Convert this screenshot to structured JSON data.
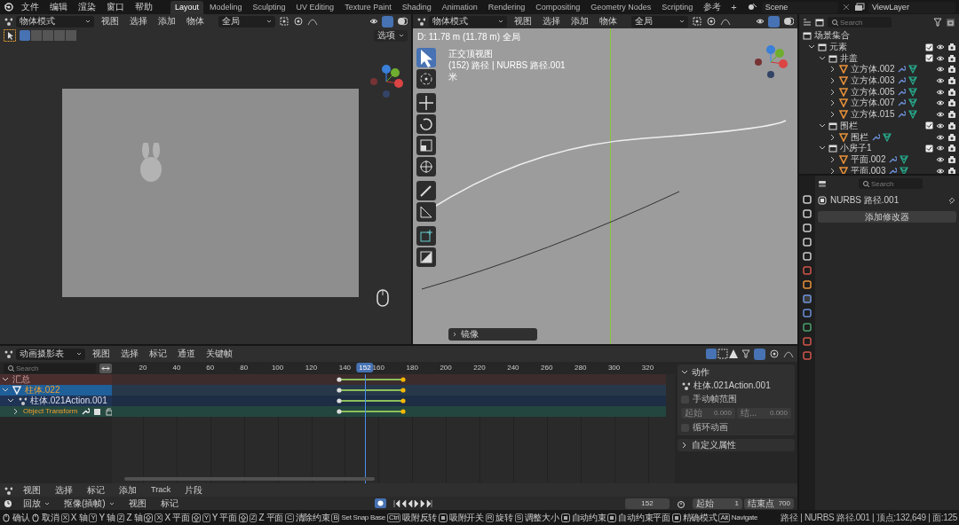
{
  "topbar": {
    "menus": [
      "文件",
      "编辑",
      "渲染",
      "窗口",
      "帮助"
    ],
    "workspaces": [
      {
        "label": "Layout",
        "selected": true
      },
      {
        "label": "Modeling",
        "selected": false
      },
      {
        "label": "Sculpting",
        "selected": false
      },
      {
        "label": "UV Editing",
        "selected": false
      },
      {
        "label": "Texture Paint",
        "selected": false
      },
      {
        "label": "Shading",
        "selected": false
      },
      {
        "label": "Animation",
        "selected": false
      },
      {
        "label": "Rendering",
        "selected": false
      },
      {
        "label": "Compositing",
        "selected": false
      },
      {
        "label": "Geometry Nodes",
        "selected": false
      },
      {
        "label": "Scripting",
        "selected": false
      },
      {
        "label": "参考",
        "selected": false
      }
    ],
    "add": "+",
    "scene": "Scene",
    "view_layer": "ViewLayer"
  },
  "viewport_left": {
    "mode": "物体模式",
    "menus": [
      "视图",
      "选择",
      "添加",
      "物体"
    ],
    "orientation": "全局",
    "options": "选项"
  },
  "viewport_right": {
    "mode": "物体模式",
    "menus": [
      "视图",
      "选择",
      "添加",
      "物体"
    ],
    "orientation": "全局",
    "measure": "D: 11.78 m (11.78 m) 全局",
    "info": [
      "正交顶视图",
      "(152) 路径 | NURBS 路径.001",
      "米"
    ],
    "tools": [
      {
        "kind": "select",
        "selected": true
      },
      {
        "kind": "cursor",
        "selected": false
      },
      {
        "kind": "move",
        "selected": false
      },
      {
        "kind": "rotate",
        "selected": false
      },
      {
        "kind": "scale",
        "selected": false
      },
      {
        "kind": "transform",
        "selected": false
      },
      {
        "kind": "annotate",
        "selected": false
      },
      {
        "kind": "measure",
        "selected": false
      },
      {
        "kind": "add",
        "selected": false
      },
      {
        "kind": "shear",
        "selected": false
      }
    ],
    "last_operator": "镜像"
  },
  "outliner": {
    "search_placeholder": "Search",
    "items": [
      {
        "label": "场景集合",
        "kind": "scene",
        "children": [
          {
            "label": "元素",
            "kind": "collection",
            "checked": true,
            "children": [
              {
                "label": "井盖",
                "kind": "collection",
                "checked": true,
                "children": [
                  {
                    "label": "立方体.002",
                    "kind": "mesh"
                  },
                  {
                    "label": "立方体.003",
                    "kind": "mesh"
                  },
                  {
                    "label": "立方体.005",
                    "kind": "mesh"
                  },
                  {
                    "label": "立方体.007",
                    "kind": "mesh"
                  },
                  {
                    "label": "立方体.015",
                    "kind": "mesh"
                  }
                ]
              },
              {
                "label": "围栏",
                "kind": "collection",
                "checked": true,
                "children": [
                  {
                    "label": "围栏",
                    "kind": "mesh"
                  }
                ]
              },
              {
                "label": "小房子1",
                "kind": "collection",
                "checked": true,
                "children": [
                  {
                    "label": "平面.002",
                    "kind": "mesh"
                  },
                  {
                    "label": "平面.003",
                    "kind": "mesh"
                  }
                ]
              }
            ]
          }
        ]
      }
    ]
  },
  "properties": {
    "search_placeholder": "Search",
    "object": "NURBS 路径.001",
    "add_modifier": "添加修改器"
  },
  "dopesheet": {
    "mode": "动画摄影表",
    "menus": [
      "视图",
      "选择",
      "标记",
      "通道",
      "关键帧"
    ],
    "search_placeholder": "Search",
    "ticks": [
      "20",
      "40",
      "60",
      "80",
      "100",
      "120",
      "140",
      "160",
      "180",
      "200",
      "220",
      "240",
      "260",
      "280",
      "300",
      "320"
    ],
    "current_frame": "152",
    "channels": [
      {
        "label": "汇总",
        "kind": "summary",
        "selected": false
      },
      {
        "label": "柱体.022",
        "kind": "object",
        "selected": true
      },
      {
        "label": "柱体.021Action.001",
        "kind": "action",
        "selected": false
      },
      {
        "label": "Object Transform",
        "kind": "group",
        "selected": false
      }
    ],
    "sidebar": {
      "section": "动作",
      "action": "柱体.021Action.001",
      "manual_range": {
        "label": "手动帧范围",
        "checked": false
      },
      "start_label": "起始",
      "start": "0.000",
      "end_label": "结...",
      "end": "0.000",
      "cyclic": {
        "label": "循环动画",
        "checked": false
      },
      "custom_props": "自定义属性"
    }
  },
  "nla": {
    "menus": [
      "视图",
      "选择",
      "标记",
      "添加",
      "Track",
      "片段"
    ]
  },
  "timeline": {
    "playback": "回放",
    "keying": "抠像(插帧)",
    "menus": [
      "视图",
      "标记"
    ],
    "frame": "152",
    "start_label": "起始",
    "start": "1",
    "end_label": "结束点",
    "end": "700"
  },
  "status_bar": {
    "items": [
      {
        "kind": "mouse",
        "label": "确认"
      },
      {
        "kind": "mouse",
        "label": "取消"
      },
      {
        "kind": "key",
        "key": "X",
        "label": "X 轴"
      },
      {
        "kind": "key",
        "key": "Y",
        "label": "Y 轴"
      },
      {
        "kind": "key",
        "key": "Z",
        "label": "Z 轴"
      },
      {
        "kind": "shift_key",
        "key": "X",
        "label": "X 平面"
      },
      {
        "kind": "shift_key",
        "key": "Y",
        "label": "Y 平面"
      },
      {
        "kind": "shift_key",
        "key": "Z",
        "label": "Z 平面"
      },
      {
        "kind": "key",
        "key": "C",
        "label": "清除约束"
      },
      {
        "kind": "key",
        "key": "B",
        "label": "Set Snap Base"
      },
      {
        "kind": "key",
        "key": "Ctrl",
        "label": "吸附反转"
      },
      {
        "kind": "icon",
        "label": "吸附开关"
      },
      {
        "kind": "key",
        "key": "R",
        "label": "旋转"
      },
      {
        "kind": "key",
        "key": "S",
        "label": "调整大小"
      },
      {
        "kind": "icon",
        "label": "自动约束"
      },
      {
        "kind": "icon",
        "label": "自动约束平面"
      },
      {
        "kind": "icon",
        "label": "精确模式"
      },
      {
        "kind": "key",
        "key": "Alt",
        "label": "Navigate"
      }
    ],
    "info": "路径 | NURBS 路径.001 | 顶点:132,649 | 面:125"
  }
}
